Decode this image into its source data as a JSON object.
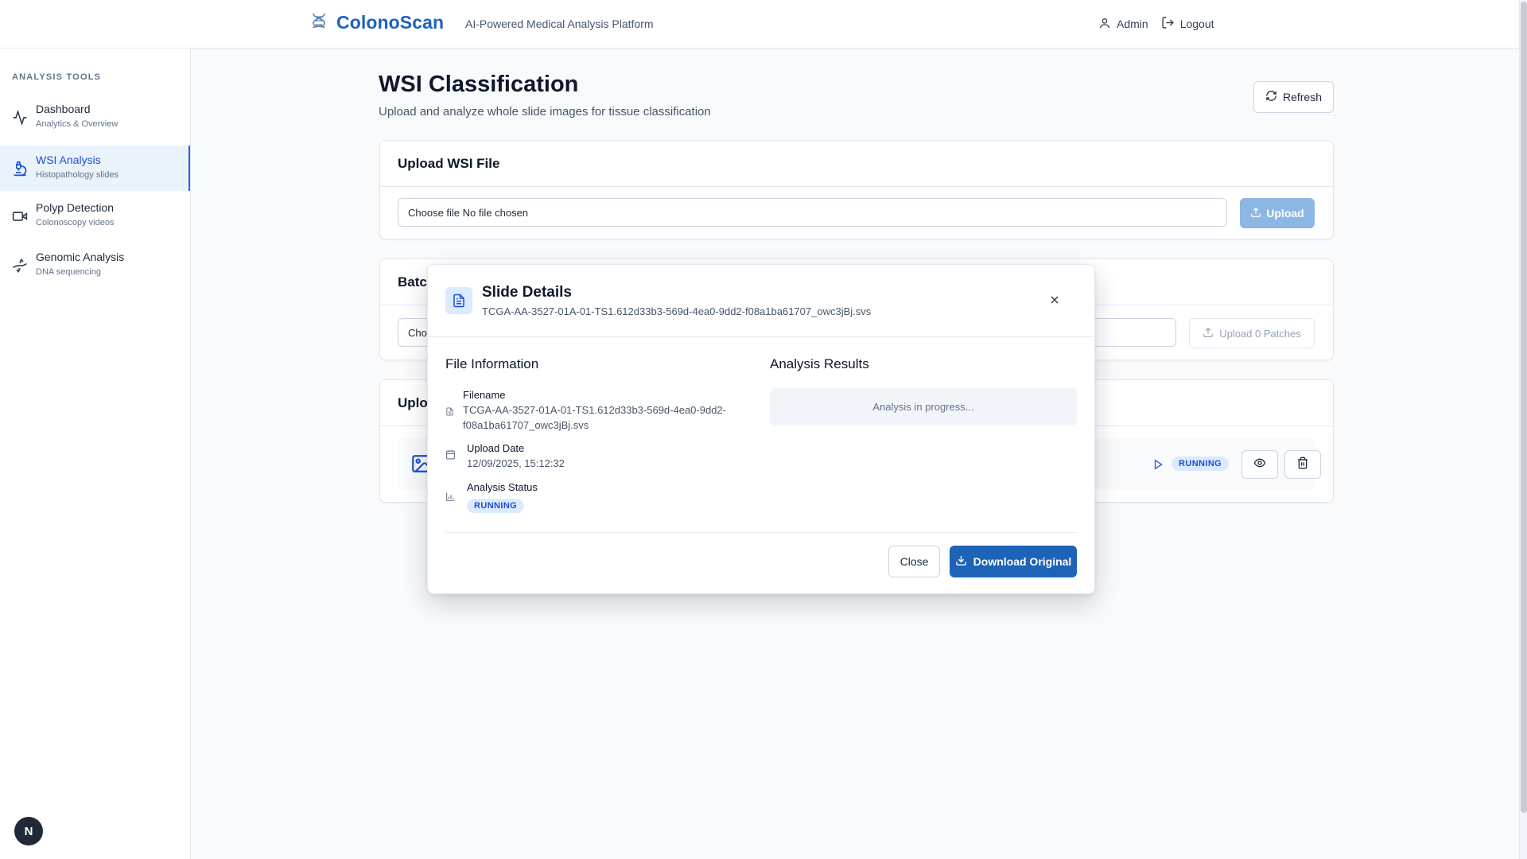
{
  "header": {
    "brand": "ColonoScan",
    "tagline": "AI-Powered Medical Analysis Platform",
    "user_label": "Admin",
    "logout_label": "Logout"
  },
  "sidebar": {
    "heading": "ANALYSIS TOOLS",
    "items": [
      {
        "label": "Dashboard",
        "sub": "Analytics & Overview",
        "icon": "activity-icon"
      },
      {
        "label": "WSI Analysis",
        "sub": "Histopathology slides",
        "icon": "microscope-icon",
        "active": true
      },
      {
        "label": "Polyp Detection",
        "sub": "Colonoscopy videos",
        "icon": "video-icon"
      },
      {
        "label": "Genomic Analysis",
        "sub": "DNA sequencing",
        "icon": "dna-icon"
      }
    ]
  },
  "page": {
    "title": "WSI Classification",
    "subtitle": "Upload and analyze whole slide images for tissue classification",
    "refresh_label": "Refresh"
  },
  "upload_card": {
    "title": "Upload WSI File",
    "file_input": "Choose file No file chosen",
    "upload_label": "Upload"
  },
  "batch_card": {
    "title": "Batc",
    "file_input": "Cho",
    "upload_label": "Upload 0 Patches"
  },
  "uploads_card": {
    "title": "Uplo",
    "row_status": "RUNNING"
  },
  "modal": {
    "title": "Slide Details",
    "subtitle": "TCGA-AA-3527-01A-01-TS1.612d33b3-569d-4ea0-9dd2-f08a1ba61707_owc3jBj.svs",
    "file_info_heading": "File Information",
    "results_heading": "Analysis Results",
    "filename_label": "Filename",
    "filename_line1": "TCGA-AA-3527-01A-01-TS1.612d33b3-569d-4ea0-9dd2-",
    "filename_line2": "f08a1ba61707_owc3jBj.svs",
    "upload_date_label": "Upload Date",
    "upload_date_value": "12/09/2025, 15:12:32",
    "status_label": "Analysis Status",
    "status_value": "RUNNING",
    "progress_text": "Analysis in progress...",
    "close_label": "Close",
    "download_label": "Download Original"
  },
  "misc": {
    "badge_letter": "N"
  },
  "colors": {
    "brand": "#1d63b8",
    "accent": "#2563eb",
    "status_bg": "#dbeafe",
    "status_text": "#1d4ed8"
  }
}
